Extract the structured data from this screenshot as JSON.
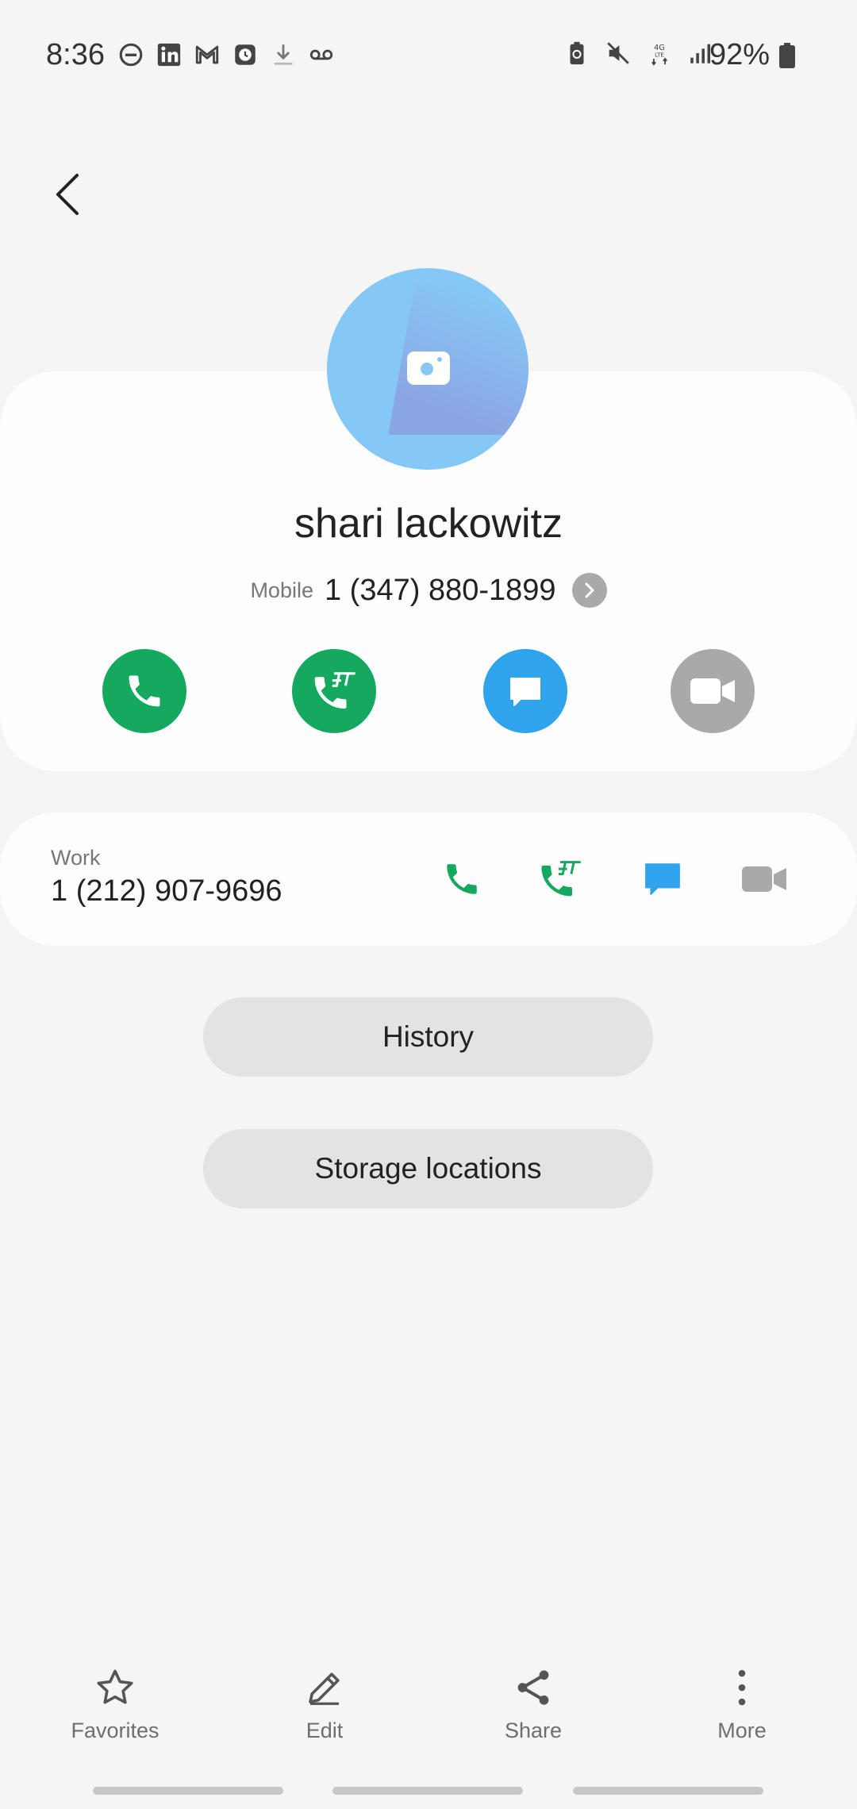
{
  "status_bar": {
    "time": "8:36",
    "battery_percent": "92%",
    "left_icons": [
      "do-not-disturb-icon",
      "linkedin-icon",
      "gmail-icon",
      "clock-app-icon",
      "download-icon",
      "voicemail-icon"
    ],
    "right_icons": [
      "battery-saver-icon",
      "mute-icon",
      "4g-lte-data-icon",
      "signal-icon"
    ]
  },
  "contact": {
    "name": "shari lackowitz",
    "mobile_label": "Mobile",
    "mobile_number": "1 (347) 880-1899"
  },
  "work": {
    "label": "Work",
    "number": "1 (212) 907-9696"
  },
  "buttons": {
    "history": "History",
    "storage": "Storage locations"
  },
  "bottom_nav": {
    "favorites": "Favorites",
    "edit": "Edit",
    "share": "Share",
    "more": "More"
  },
  "colors": {
    "call_green": "#15a85f",
    "message_blue": "#2fa3ec",
    "video_gray": "#a9a9a9",
    "avatar_blue": "#86c8f5"
  }
}
